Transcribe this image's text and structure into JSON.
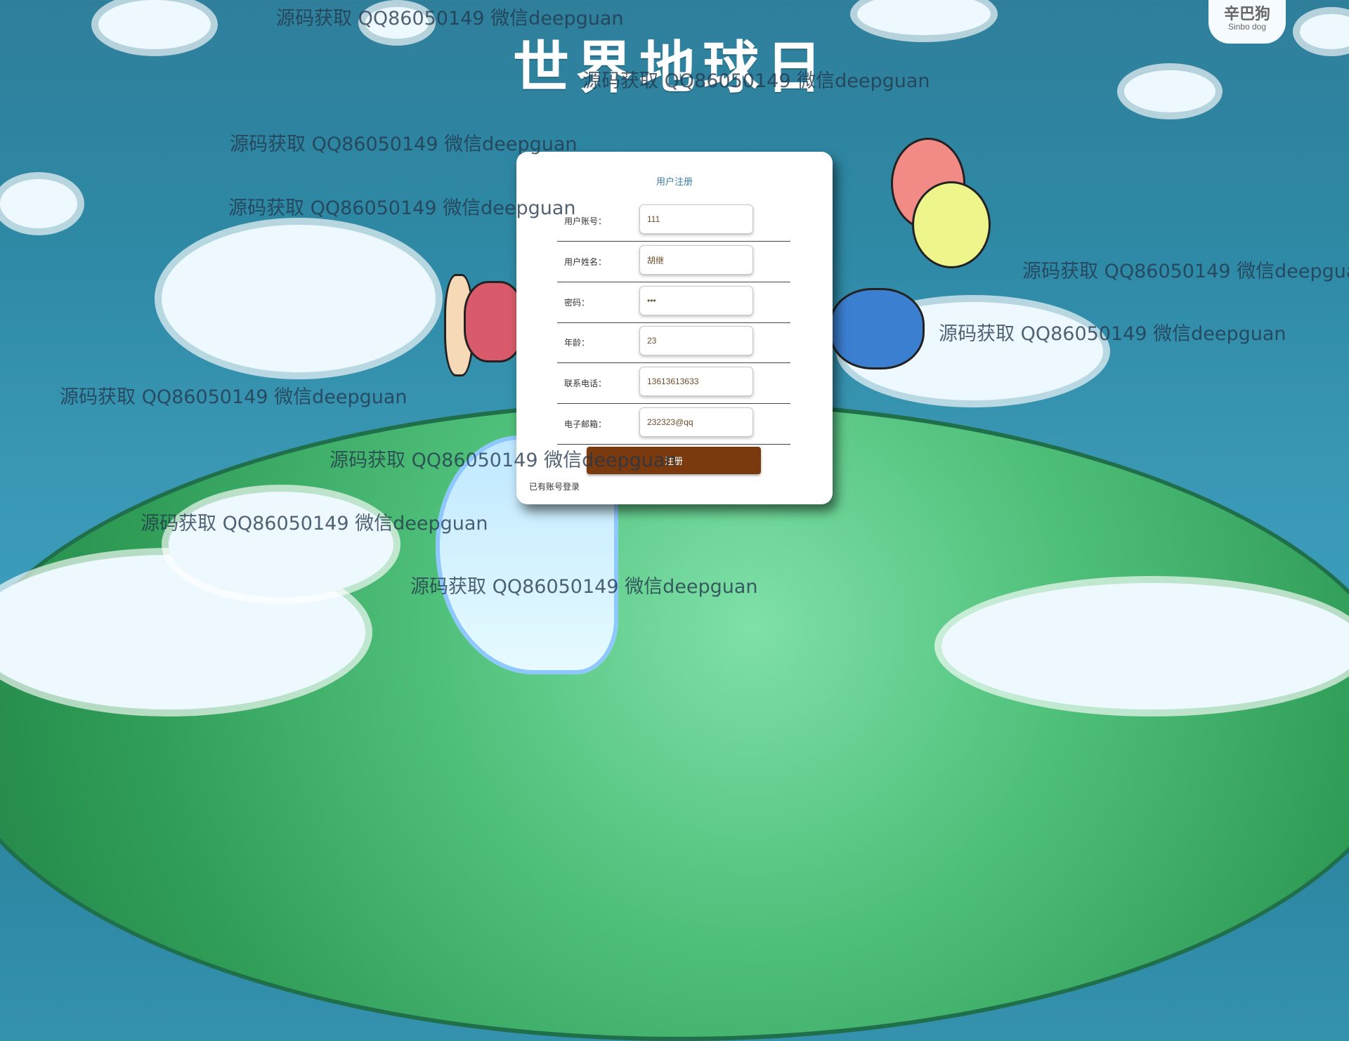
{
  "page": {
    "banner_title": "世界地球日",
    "brand": {
      "chinese": "辛巴狗",
      "english": "Sinbo dog"
    }
  },
  "watermark_text": "源码获取 QQ86050149 微信deepguan",
  "form": {
    "title": "用户注册",
    "fields": [
      {
        "label": "用户账号：",
        "value": "111",
        "type": "text"
      },
      {
        "label": "用户姓名：",
        "value": "胡继",
        "type": "text"
      },
      {
        "label": "密码：",
        "value": "111",
        "type": "password"
      },
      {
        "label": "年龄：",
        "value": "23",
        "type": "text"
      },
      {
        "label": "联系电话：",
        "value": "13613613633",
        "type": "text"
      },
      {
        "label": "电子邮箱：",
        "value": "232323@qq",
        "type": "text"
      }
    ],
    "submit_label": "注册",
    "login_link": "已有账号登录"
  },
  "colors": {
    "submit": "#7a3a0d",
    "title_text": "#3b7fa6",
    "sky": "#2f86a3"
  }
}
